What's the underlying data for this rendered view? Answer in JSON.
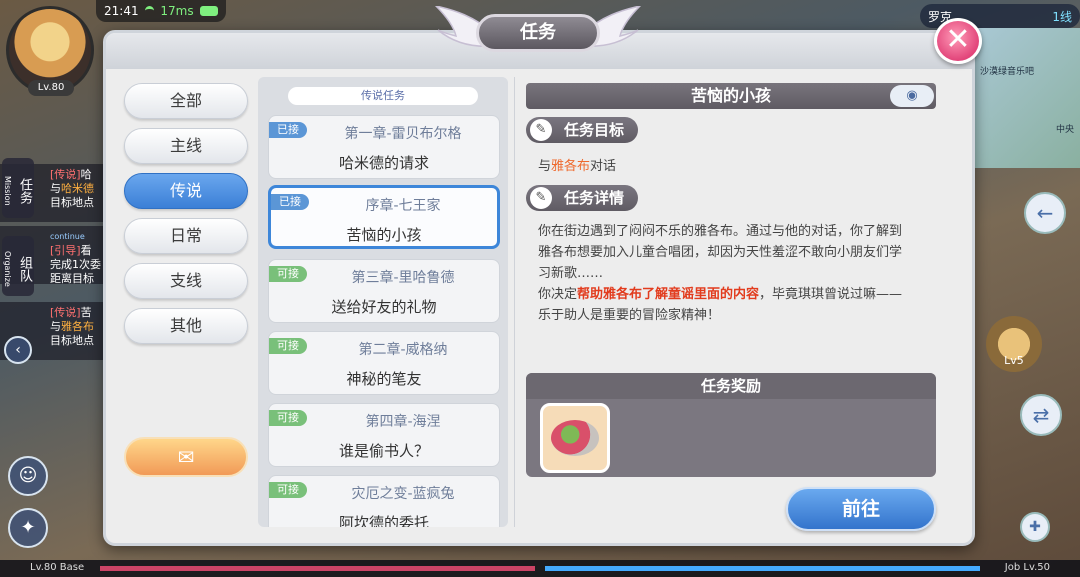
{
  "hud": {
    "time": "21:41",
    "ping": "17ms",
    "player_level": "Lv.80",
    "channel_name": "罗克",
    "channel_line": "1线",
    "map_label": "沙漠绿音乐吧",
    "map_center": "中央",
    "side_quests": [
      {
        "tag": "[传说]",
        "line1": "哈",
        "line2_prefix": "与",
        "line2_highlight": "哈米德",
        "line3": "目标地点"
      },
      {
        "tag": "[引导]",
        "line1": "看",
        "line2_prefix": "完成1次委",
        "line2_highlight": "",
        "line3": "距离目标"
      },
      {
        "tag": "[传说]",
        "line1": "苦",
        "line2_prefix": "与",
        "line2_highlight": "雅各布",
        "line3": "目标地点"
      }
    ],
    "continue_label": "continue",
    "side_tab_mission": "任务",
    "side_tab_mission_en": "Mission",
    "side_tab_team": "组队",
    "side_tab_team_en": "Organize",
    "right_level": "Lv5",
    "base_level": "Lv.80 Base",
    "job_level": "Job Lv.50"
  },
  "dialog": {
    "title": "任务",
    "close_symbol": "✕",
    "categories": [
      {
        "label": "全部",
        "active": false
      },
      {
        "label": "主线",
        "active": false
      },
      {
        "label": "传说",
        "active": true
      },
      {
        "label": "日常",
        "active": false
      },
      {
        "label": "支线",
        "active": false
      },
      {
        "label": "其他",
        "active": false
      }
    ],
    "special_button_icon": "gift-icon"
  },
  "quest_list": {
    "header": "传说任务",
    "items": [
      {
        "status": "已接",
        "chapter": "第一章-雷贝布尔格",
        "name": "哈米德的请求",
        "selected": false
      },
      {
        "status": "已接",
        "chapter": "序章-七王家",
        "name": "苦恼的小孩",
        "selected": true
      },
      {
        "status": "可接",
        "chapter": "第三章-里哈鲁德",
        "name": "送给好友的礼物",
        "selected": false
      },
      {
        "status": "可接",
        "chapter": "第二章-威格纳",
        "name": "神秘的笔友",
        "selected": false
      },
      {
        "status": "可接",
        "chapter": "第四章-海涅",
        "name": "谁是偷书人？",
        "selected": false
      },
      {
        "status": "可接",
        "chapter": "灾厄之变-蓝疯兔",
        "name": "阿坎德的委托",
        "selected": false
      }
    ]
  },
  "detail": {
    "title": "苦恼的小孩",
    "goal_label": "任务目标",
    "goal_prefix": "与",
    "goal_npc": "雅各布",
    "goal_suffix": "对话",
    "details_label": "任务详情",
    "desc_line1": "你在街边遇到了闷闷不乐的雅各布。通过与他的对话，你了解到",
    "desc_line2": "雅各布想要加入儿童合唱团，却因为天性羞涩不敢向小朋友们学",
    "desc_line3": "习新歌……",
    "desc_line4_prefix": "你决定",
    "desc_line4_emph": "帮助雅各布了解童谣里面的内容",
    "desc_line4_suffix": "，毕竟琪琪曾说过嘛——",
    "desc_line5": "乐于助人是重要的冒险家精神！",
    "reward_label": "任务奖励",
    "reward_item_icon": "food-plate-icon",
    "go_label": "前往"
  },
  "colors": {
    "accent_blue": "#3b7fd6",
    "npc_orange": "#ee6a2e",
    "emphasis_red": "#e23c1e",
    "close_pink": "#e2457a"
  }
}
